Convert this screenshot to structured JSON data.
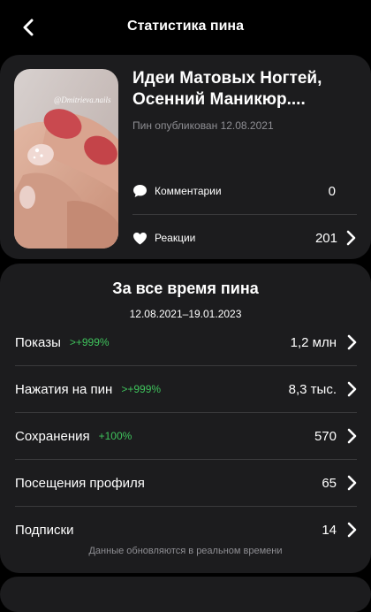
{
  "header": {
    "title": "Статистика пина"
  },
  "pin": {
    "watermark": "@Dmitrieva.nails",
    "title": "Идеи Матовых Ногтей, Осенний Маникюр....",
    "published": "Пин опубликован 12.08.2021",
    "comments_label": "Комментарии",
    "comments_value": "0",
    "reactions_label": "Реакции",
    "reactions_value": "201"
  },
  "lifetime": {
    "title": "За все время пина",
    "range": "12.08.2021–19.01.2023",
    "metrics": [
      {
        "label": "Показы",
        "delta": ">+999%",
        "value": "1,2 млн"
      },
      {
        "label": "Нажатия на пин",
        "delta": ">+999%",
        "value": "8,3 тыс."
      },
      {
        "label": "Сохранения",
        "delta": "+100%",
        "value": "570"
      },
      {
        "label": "Посещения профиля",
        "delta": "",
        "value": "65"
      },
      {
        "label": "Подписки",
        "delta": "",
        "value": "14"
      }
    ],
    "footnote": "Данные обновляются в реальном времени"
  },
  "colors": {
    "background": "#000000",
    "card": "#1c1c1e",
    "positive_delta": "#3fc35c",
    "muted": "#8e8e93"
  },
  "icons": {
    "back": "chevron-left-icon",
    "comments": "speech-bubble-icon",
    "reactions": "heart-icon",
    "row_nav": "chevron-right-icon"
  }
}
